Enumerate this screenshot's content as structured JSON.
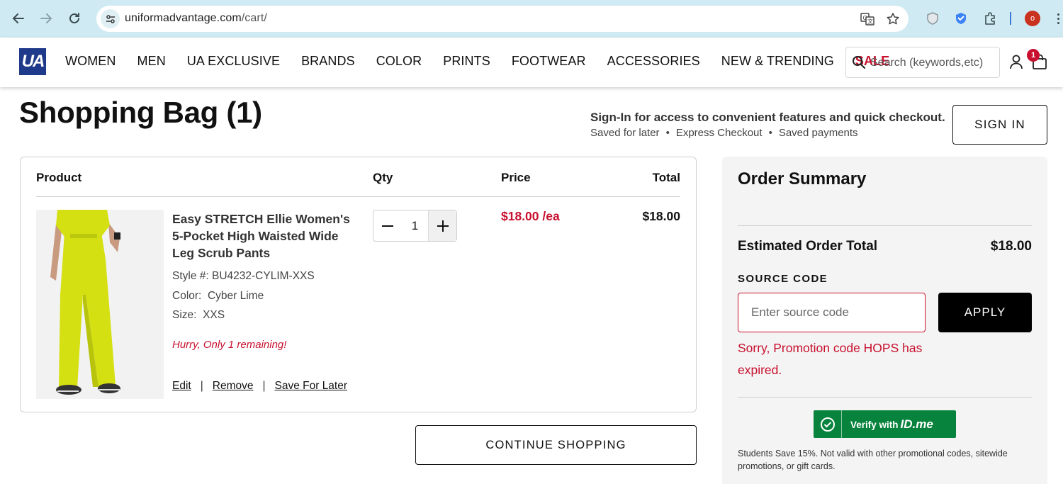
{
  "browser": {
    "url_domain": "uniformadvantage.com",
    "url_path": "/cart/",
    "profile_initial": "o",
    "icons": [
      "back-icon",
      "forward-icon",
      "reload-icon",
      "site-info-icon",
      "translate-icon",
      "bookmark-star-icon",
      "shield-extension-icon",
      "vpn-extension-icon",
      "puzzle-extensions-icon",
      "more-menu-icon"
    ]
  },
  "header": {
    "logo_text": "UA",
    "nav": [
      "WOMEN",
      "MEN",
      "UA EXCLUSIVE",
      "BRANDS",
      "COLOR",
      "PRINTS",
      "FOOTWEAR",
      "ACCESSORIES",
      "NEW & TRENDING"
    ],
    "sale_label": "SALE",
    "search_placeholder": "Search (keywords,etc)",
    "bag_count": "1"
  },
  "page": {
    "title": "Shopping Bag (1)",
    "signin_heading": "Sign-In for access to convenient features and quick checkout.",
    "signin_benefits": [
      "Saved for later",
      "Express Checkout",
      "Saved payments"
    ],
    "signin_button": "SIGN IN"
  },
  "cart": {
    "headers": {
      "product": "Product",
      "qty": "Qty",
      "price": "Price",
      "total": "Total"
    },
    "items": [
      {
        "name": "Easy STRETCH Ellie Women's 5-Pocket High Waisted Wide Leg Scrub Pants",
        "style": "Style #: BU4232-CYLIM-XXS",
        "color": "Color:  Cyber Lime",
        "size": "Size:  XXS",
        "stock_note": "Hurry, Only 1 remaining!",
        "qty": "1",
        "price": "$18.00 /ea",
        "total": "$18.00",
        "actions": {
          "edit": "Edit",
          "remove": "Remove",
          "save": "Save For Later"
        },
        "image_color": "#d4e012"
      }
    ],
    "continue_button": "CONTINUE SHOPPING"
  },
  "summary": {
    "title": "Order Summary",
    "estimated_label": "Estimated Order Total",
    "estimated_value": "$18.00",
    "source_code_label": "SOURCE CODE",
    "source_code_placeholder": "Enter source code",
    "apply_button": "APPLY",
    "promo_error": "Sorry, Promotion code HOPS has expired.",
    "idme_label": "Verify with",
    "idme_brand": "ID.me",
    "students_note": "Students Save 15%. Not valid with other promotional codes, sitewide promotions, or gift cards."
  },
  "colors": {
    "accent_red": "#c8102e",
    "brand_blue": "#1f3a8a",
    "idme_green": "#08833d",
    "chrome_bg": "#cfeaf2"
  }
}
